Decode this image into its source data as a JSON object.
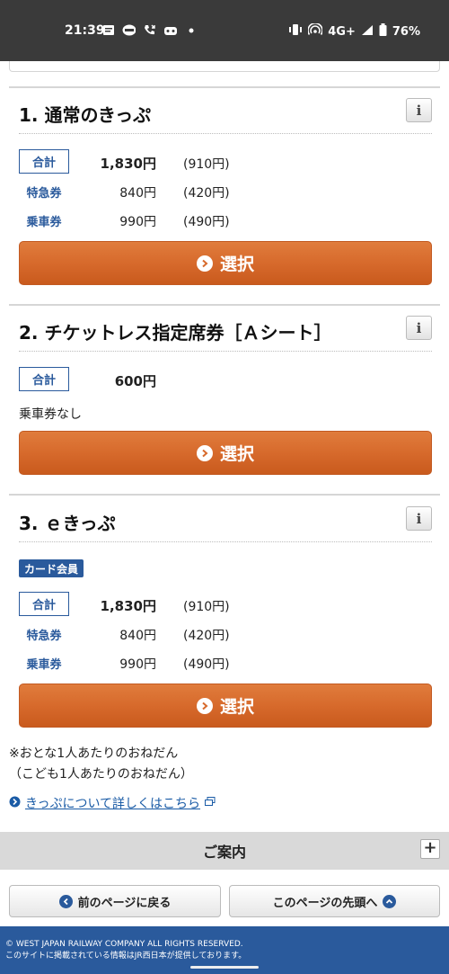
{
  "status_bar": {
    "time": "21:39",
    "network": "4G+",
    "battery": "76%"
  },
  "sections": [
    {
      "title": "1. 通常のきっぷ",
      "info": "i",
      "sum_label": "合計",
      "sum_amount": "1,830円",
      "sum_paren": "(910円)",
      "rows": [
        {
          "label": "特急券",
          "amount": "840円",
          "paren": "(420円)"
        },
        {
          "label": "乗車券",
          "amount": "990円",
          "paren": "(490円)"
        }
      ],
      "select_label": "選択"
    },
    {
      "title": "2. チケットレス指定席券［Ａシート］",
      "info": "i",
      "sum_label": "合計",
      "sum_amount": "600円",
      "note": "乗車券なし",
      "select_label": "選択"
    },
    {
      "title": "3. ｅきっぷ",
      "info": "i",
      "badge": "カード会員",
      "sum_label": "合計",
      "sum_amount": "1,830円",
      "sum_paren": "(910円)",
      "rows": [
        {
          "label": "特急券",
          "amount": "840円",
          "paren": "(420円)"
        },
        {
          "label": "乗車券",
          "amount": "990円",
          "paren": "(490円)"
        }
      ],
      "select_label": "選択"
    }
  ],
  "notes": {
    "line1": "※おとな1人あたりのおねだん",
    "line2": "（こども1人あたりのおねだん）"
  },
  "details_link": "きっぷについて詳しくはこちら",
  "guide": {
    "title": "ご案内",
    "expand": "+"
  },
  "nav": {
    "back": "前のページに戻る",
    "top": "このページの先頭へ"
  },
  "footer": {
    "copyright": "© WEST JAPAN RAILWAY COMPANY ALL RIGHTS RESERVED.",
    "provider": "このサイトに掲載されている情報はJR西日本が提供しております。"
  },
  "colors": {
    "accent_orange": "#d76a2c",
    "brand_blue": "#2a5a9c",
    "link_blue": "#1a5ba6"
  }
}
